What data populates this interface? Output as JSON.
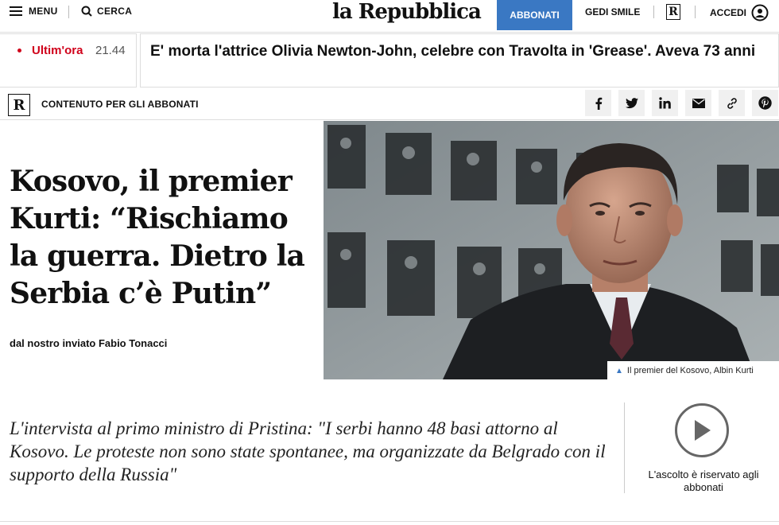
{
  "header": {
    "menu_label": "MENU",
    "search_label": "CERCA",
    "logo_text": "la Repubblica",
    "subscribe_label": "ABBONATI",
    "gedi_label": "GEDI SMILE",
    "r_badge": "R",
    "login_label": "ACCEDI",
    "accent_color": "#3a78c3"
  },
  "ticker": {
    "label": "Ultim'ora",
    "time": "21.44",
    "text": "E' morta l'attrice Olivia Newton-John, celebre con Travolta in 'Grease'. Aveva 73 anni",
    "label_color": "#d0021b"
  },
  "subbar": {
    "badge": "R",
    "premium_label": "CONTENUTO PER GLI ABBONATI",
    "share_icons": [
      "facebook-icon",
      "twitter-icon",
      "linkedin-icon",
      "email-icon",
      "link-icon",
      "pinterest-icon"
    ]
  },
  "article": {
    "headline": "Kosovo, il premier Kurti: “Rischiamo la guerra. Dietro la Serbia c’è Putin”",
    "byline": "dal nostro inviato Fabio Tonacci",
    "photo_caption": "Il premier del Kosovo, Albin Kurti",
    "lead": "L'intervista al primo ministro di Pristina: \"I serbi hanno 48 basi attorno al Kosovo. Le proteste non sono state spontanee, ma organizzate da Belgrado con il supporto della Russia\""
  },
  "audio": {
    "label": "L'ascolto è riservato agli abbonati"
  }
}
